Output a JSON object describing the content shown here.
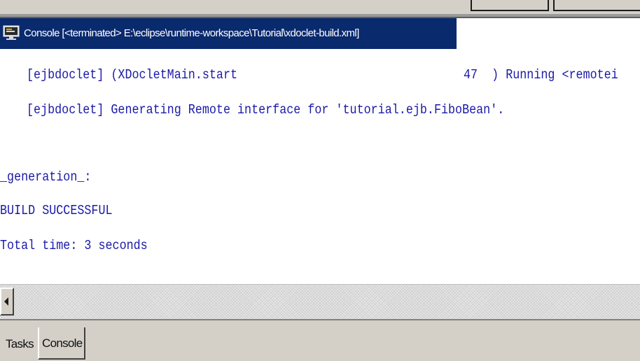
{
  "view": {
    "title": "Console [<terminated> E:\\eclipse\\runtime-workspace\\Tutorial\\xdoclet-build.xml]",
    "icon": "console-icon"
  },
  "console": {
    "lines": [
      "[ejbdoclet] (XDocletMain.start",
      "47  ) Running <remotei",
      "[ejbdoclet] Generating Remote interface for 'tutorial.ejb.FiboBean'.",
      "_generation_:",
      "BUILD SUCCESSFUL",
      "Total time: 3 seconds"
    ]
  },
  "tabs": [
    {
      "label": "Tasks",
      "active": false
    },
    {
      "label": "Console",
      "active": true
    }
  ],
  "colors": {
    "title_bg": "#0a2a6e",
    "console_text": "#1a1aa8",
    "chrome": "#d4d0c8"
  }
}
